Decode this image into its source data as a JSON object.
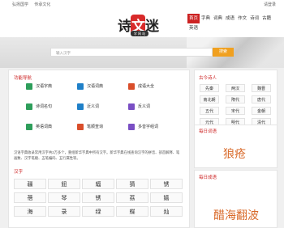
{
  "topbar": {
    "links": [
      "弘扬国学",
      "传承文化"
    ],
    "right": "请登录"
  },
  "logo": {
    "part1": "诗",
    "part2": "文",
    "part3": "迷",
    "sub": "学 网 站"
  },
  "nav": [
    "首页",
    "字典",
    "词典",
    "成语",
    "作文",
    "诗词",
    "古籍",
    "英语"
  ],
  "search": {
    "placeholder": "输入汉字",
    "button": "搜索"
  },
  "features": {
    "title": "功能导航",
    "items": [
      {
        "label": "汉语字典",
        "color": "#2e9e5b"
      },
      {
        "label": "汉语词典",
        "color": "#1f80c8"
      },
      {
        "label": "成语大全",
        "color": "#d94e2b"
      },
      {
        "label": "诗词名句",
        "color": "#2e9e5b"
      },
      {
        "label": "近义词",
        "color": "#1f80c8"
      },
      {
        "label": "反义词",
        "color": "#7a4fc4"
      },
      {
        "label": "英语词典",
        "color": "#2e9e5b"
      },
      {
        "label": "笔顺查询",
        "color": "#d94e2b"
      },
      {
        "label": "多音字组词",
        "color": "#7a4fc4"
      }
    ]
  },
  "description": "汉语字典收录常用汉字共2万多个，重组新华字典中所有汉字。新华字典在线查询汉字的拼音、部首解释、笔画数、汉字笔顺、五笔编码、五行属性等。",
  "chars": {
    "title": "汉字",
    "rows": [
      [
        "疆",
        "鈕",
        "蝠",
        "猜",
        "锈"
      ],
      [
        "蓓",
        "琴",
        "锈",
        "荔",
        "嬉"
      ],
      [
        "海",
        "录",
        "绿",
        "蝶",
        "灿"
      ]
    ]
  },
  "poets": {
    "title": "古今诗人",
    "dynasties": [
      "先秦",
      "两汉",
      "魏晋",
      "南北朝",
      "隋代",
      "唐代",
      "五代",
      "宋代",
      "金朝",
      "元代",
      "明代",
      "清代"
    ]
  },
  "daily_word": {
    "title": "每日词语",
    "word": "狼疮"
  },
  "daily_idiom": {
    "title": "每日成语",
    "idiom": "醋海翻波"
  }
}
